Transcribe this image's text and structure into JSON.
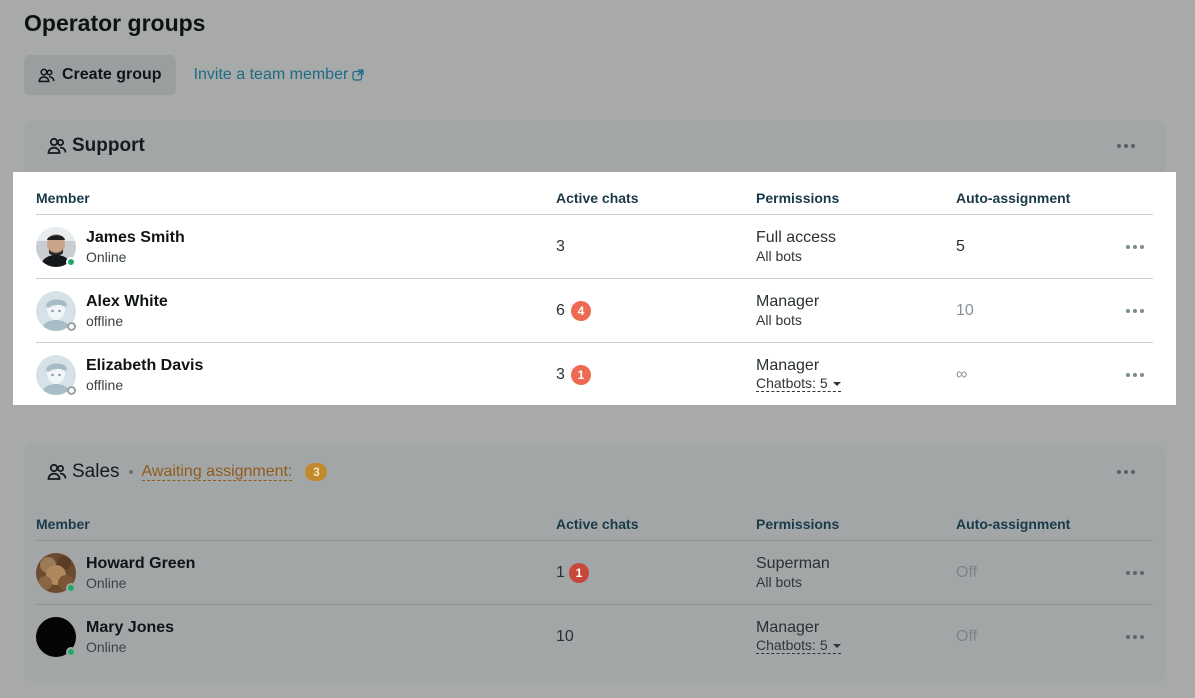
{
  "page": {
    "title": "Operator groups"
  },
  "toolbar": {
    "create_group_label": "Create group",
    "invite_label": "Invite a team member"
  },
  "columns": {
    "member": "Member",
    "active_chats": "Active chats",
    "permissions": "Permissions",
    "auto_assignment": "Auto-assignment"
  },
  "colors": {
    "badge_red": "#ec6a52",
    "badge_dark_red": "#c8473a",
    "await_badge": "#c28a2c",
    "online": "#1eaa6a"
  },
  "groups": [
    {
      "name": "Support",
      "members": [
        {
          "name": "James Smith",
          "status": "Online",
          "active_chats": "3",
          "badge": "",
          "permission": "Full access",
          "permission_sub": "All bots",
          "auto": "5",
          "avatar": "photo-man-dark"
        },
        {
          "name": "Alex White",
          "status": "offline",
          "active_chats": "6",
          "badge": "4",
          "permission": "Manager",
          "permission_sub": "All bots",
          "auto": "10",
          "avatar": "default-avatar-icon"
        },
        {
          "name": "Elizabeth Davis",
          "status": "offline",
          "active_chats": "3",
          "badge": "1",
          "permission": "Manager",
          "permission_sub": "Chatbots: 5",
          "auto": "∞",
          "avatar": "default-avatar-icon"
        }
      ]
    },
    {
      "name": "Sales",
      "awaiting_label": "Awaiting assignment:",
      "awaiting_count": "3",
      "members": [
        {
          "name": "Howard Green",
          "status": "Online",
          "active_chats": "1",
          "badge": "1",
          "permission": "Superman",
          "permission_sub": "All bots",
          "auto": "Off",
          "avatar": "photo-brown"
        },
        {
          "name": "Mary Jones",
          "status": "Online",
          "active_chats": "10",
          "badge": "",
          "permission": "Manager",
          "permission_sub": "Chatbots: 5",
          "auto": "Off",
          "avatar": "photo-black"
        }
      ]
    }
  ]
}
